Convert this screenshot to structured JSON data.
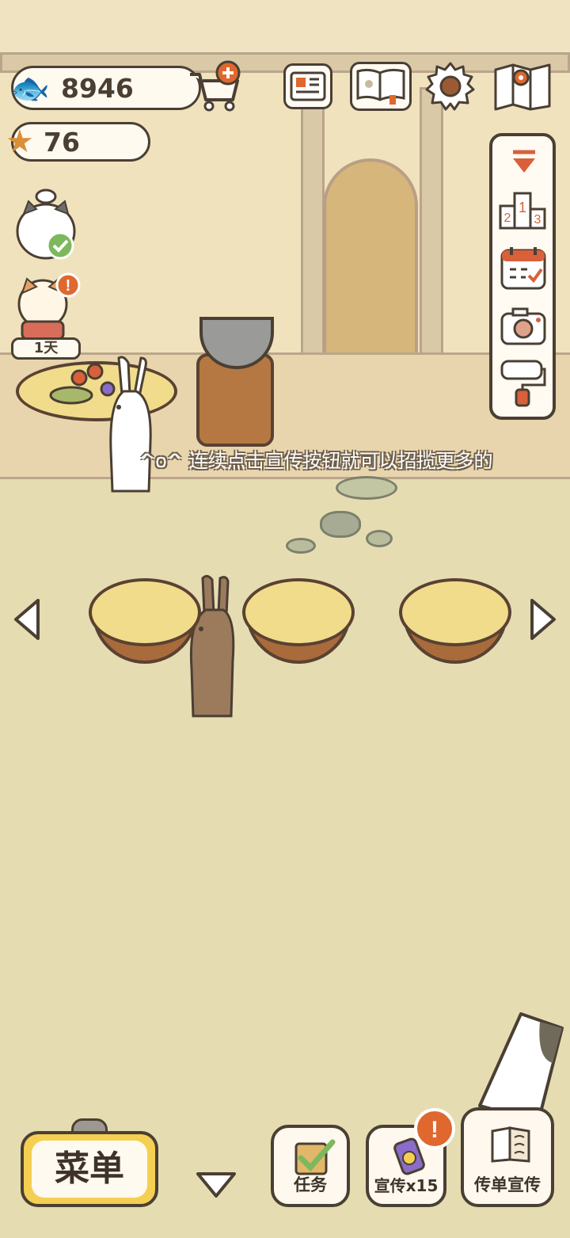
{
  "currency": {
    "fish_count": "8946",
    "star_count": "76"
  },
  "status": {
    "day_label": "1天"
  },
  "ticker": {
    "message": "^o^ 连续点击宣传按钮就可以招揽更多的"
  },
  "bottom_bar": {
    "menu_label": "菜单",
    "tasks_label": "任务",
    "promote_label": "宣传x15",
    "flyer_label": "传单宣传"
  },
  "colors": {
    "accent_orange": "#e0672e",
    "menu_yellow": "#f5cf52",
    "outline": "#4a3f33"
  },
  "icons": {
    "top_bar": [
      "fish-icon",
      "cart-plus-icon",
      "newspaper-icon",
      "recipe-book-icon",
      "gear-icon",
      "map-icon"
    ],
    "side_panel": [
      "collapse-arrow-icon",
      "ranking-podium-icon",
      "calendar-check-icon",
      "camera-icon",
      "paint-roller-icon"
    ]
  }
}
